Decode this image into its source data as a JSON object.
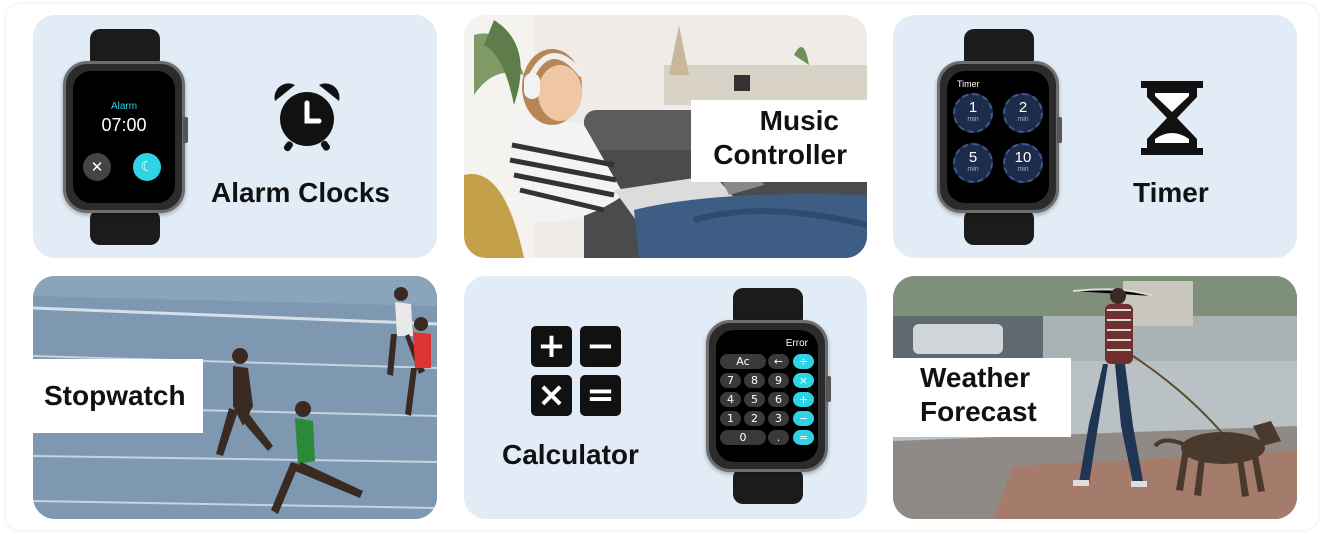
{
  "features": {
    "alarm": {
      "title": "Alarm Clocks",
      "icon": "alarm-clock-icon",
      "screen_label": "Alarm",
      "screen_time": "07:00",
      "dismiss_icon": "close-icon",
      "snooze_icon": "moon-icon"
    },
    "music": {
      "title_line1": "Music",
      "title_line2": "Controller"
    },
    "timer": {
      "title": "Timer",
      "icon": "hourglass-icon",
      "screen_label": "Timer",
      "presets": [
        {
          "value": "1",
          "unit": "min"
        },
        {
          "value": "2",
          "unit": "min"
        },
        {
          "value": "5",
          "unit": "min"
        },
        {
          "value": "10",
          "unit": "min"
        }
      ]
    },
    "stopwatch": {
      "title": "Stopwatch"
    },
    "calculator": {
      "title": "Calculator",
      "icon": "calculator-symbols-icon",
      "display": "Error",
      "symbols": [
        "+",
        "−",
        "×",
        "="
      ],
      "keys": {
        "ac": "Ac",
        "back": "←",
        "div": "÷",
        "k7": "7",
        "k8": "8",
        "k9": "9",
        "mul": "×",
        "k4": "4",
        "k5": "5",
        "k6": "6",
        "add": "+",
        "k1": "1",
        "k2": "2",
        "k3": "3",
        "sub": "−",
        "k0": "0",
        "dot": ".",
        "eq": "="
      }
    },
    "weather": {
      "title_line1": "Weather",
      "title_line2": "Forecast"
    }
  },
  "colors": {
    "tile_bg": "#e1ecf7",
    "accent_cyan": "#2ed3e6",
    "text": "#111111"
  }
}
